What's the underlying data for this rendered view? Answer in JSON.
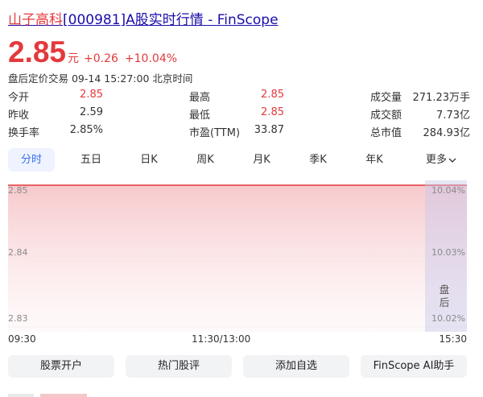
{
  "header": {
    "title_name": "山子高科",
    "title_rest": "[000981]A股实时行情 - FinScope"
  },
  "quote": {
    "price": "2.85",
    "unit": "元",
    "change": "+0.26",
    "change_pct": "+10.04%",
    "status": "盘后定价交易 09-14 15:27:00 北京时间"
  },
  "stats": [
    {
      "label": "今开",
      "value": "2.85",
      "color": "#e4393c"
    },
    {
      "label": "最高",
      "value": "2.85",
      "color": "#e4393c"
    },
    {
      "label": "成交量",
      "value": "271.23万手",
      "color": "#333333"
    },
    {
      "label": "昨收",
      "value": "2.59",
      "color": "#333333"
    },
    {
      "label": "最低",
      "value": "2.85",
      "color": "#e4393c"
    },
    {
      "label": "成交额",
      "value": "7.73亿",
      "color": "#333333"
    },
    {
      "label": "换手率",
      "value": "2.85%",
      "color": "#333333"
    },
    {
      "label": "市盈(TTM)",
      "value": "33.87",
      "color": "#333333"
    },
    {
      "label": "总市值",
      "value": "284.93亿",
      "color": "#333333"
    }
  ],
  "tabs": [
    {
      "label": "分时",
      "active": true
    },
    {
      "label": "五日"
    },
    {
      "label": "日K"
    },
    {
      "label": "周K"
    },
    {
      "label": "月K"
    },
    {
      "label": "季K"
    },
    {
      "label": "年K"
    },
    {
      "label": "更多"
    }
  ],
  "chart_data": {
    "type": "line",
    "y_labels": [
      "2.85",
      "2.84",
      "2.83"
    ],
    "right_labels": [
      "10.04%",
      "10.03%",
      "10.02%"
    ],
    "x_labels": [
      "09:30",
      "11:30/13:00",
      "15:30"
    ],
    "series": [
      {
        "values": [
          2.85,
          2.85
        ]
      }
    ],
    "ylim": [
      2.83,
      2.85
    ],
    "after_hours_label": "盘后",
    "line_color": "#e4393c"
  },
  "actions": [
    "股票开户",
    "热门股评",
    "添加自选",
    "FinScope AI助手"
  ],
  "colors": {
    "accent_red": "#e4393c",
    "link_blue": "#1a0dab",
    "tab_active": "#3a6ff0"
  }
}
